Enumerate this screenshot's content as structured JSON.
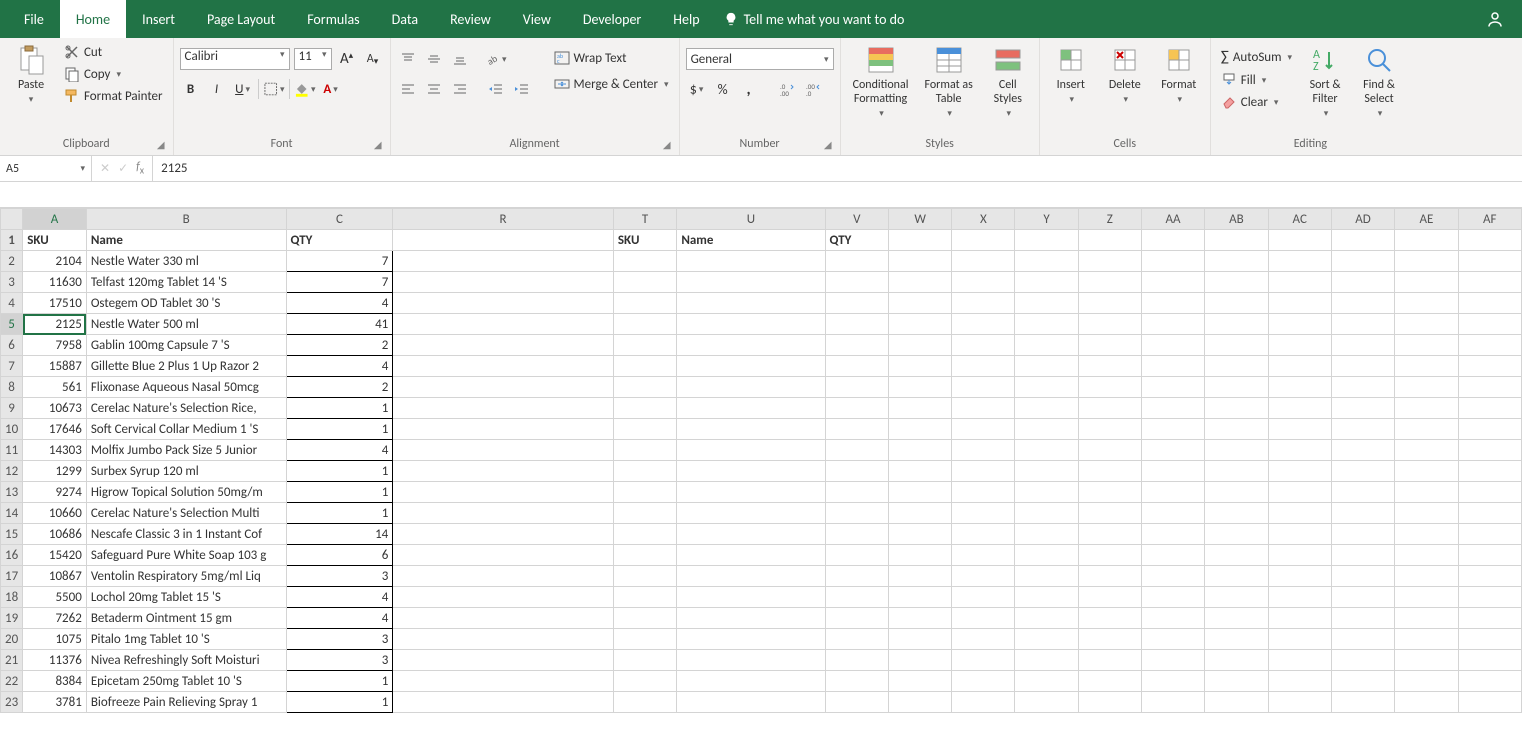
{
  "tabs": [
    "File",
    "Home",
    "Insert",
    "Page Layout",
    "Formulas",
    "Data",
    "Review",
    "View",
    "Developer",
    "Help"
  ],
  "active_tab": "Home",
  "tell_me": "Tell me what you want to do",
  "clipboard": {
    "paste": "Paste",
    "cut": "Cut",
    "copy": "Copy",
    "format_painter": "Format Painter",
    "label": "Clipboard"
  },
  "font": {
    "name": "Calibri",
    "size": "11",
    "label": "Font"
  },
  "alignment": {
    "wrap": "Wrap Text",
    "merge": "Merge & Center",
    "label": "Alignment"
  },
  "number": {
    "format": "General",
    "label": "Number"
  },
  "styles": {
    "cond": "Conditional Formatting",
    "table": "Format as Table",
    "cell": "Cell Styles",
    "label": "Styles"
  },
  "cells": {
    "insert": "Insert",
    "delete": "Delete",
    "format": "Format",
    "label": "Cells"
  },
  "editing": {
    "autosum": "AutoSum",
    "fill": "Fill",
    "clear": "Clear",
    "sort": "Sort & Filter",
    "find": "Find & Select",
    "label": "Editing"
  },
  "name_box": "A5",
  "formula_value": "2125",
  "col_headers": [
    "A",
    "B",
    "C",
    "R",
    "T",
    "U",
    "V",
    "W",
    "X",
    "Y",
    "Z",
    "AA",
    "AB",
    "AC",
    "AD",
    "AE",
    "AF"
  ],
  "header_row": {
    "A": "SKU",
    "B": "Name",
    "C": "QTY",
    "T": "SKU",
    "U": "Name",
    "V": "QTY"
  },
  "rows": [
    {
      "r": 2,
      "sku": "2104",
      "name": "Nestle Water 330 ml",
      "qty": "7"
    },
    {
      "r": 3,
      "sku": "11630",
      "name": "Telfast 120mg Tablet 14 'S",
      "qty": "7"
    },
    {
      "r": 4,
      "sku": "17510",
      "name": "Ostegem OD Tablet 30 'S",
      "qty": "4"
    },
    {
      "r": 5,
      "sku": "2125",
      "name": "Nestle Water 500 ml",
      "qty": "41"
    },
    {
      "r": 6,
      "sku": "7958",
      "name": "Gablin 100mg Capsule 7 'S",
      "qty": "2"
    },
    {
      "r": 7,
      "sku": "15887",
      "name": "Gillette Blue 2 Plus 1 Up Razor 2",
      "qty": "4"
    },
    {
      "r": 8,
      "sku": "561",
      "name": "Flixonase Aqueous Nasal 50mcg",
      "qty": "2"
    },
    {
      "r": 9,
      "sku": "10673",
      "name": "Cerelac Nature's Selection Rice,",
      "qty": "1"
    },
    {
      "r": 10,
      "sku": "17646",
      "name": "Soft Cervical Collar Medium 1 'S",
      "qty": "1"
    },
    {
      "r": 11,
      "sku": "14303",
      "name": "Molfix Jumbo Pack Size 5 Junior",
      "qty": "4"
    },
    {
      "r": 12,
      "sku": "1299",
      "name": "Surbex Syrup 120 ml",
      "qty": "1"
    },
    {
      "r": 13,
      "sku": "9274",
      "name": "Higrow Topical Solution 50mg/m",
      "qty": "1"
    },
    {
      "r": 14,
      "sku": "10660",
      "name": "Cerelac Nature's Selection Multi",
      "qty": "1"
    },
    {
      "r": 15,
      "sku": "10686",
      "name": "Nescafe Classic 3 in 1 Instant Cof",
      "qty": "14"
    },
    {
      "r": 16,
      "sku": "15420",
      "name": "Safeguard Pure White Soap 103 g",
      "qty": "6"
    },
    {
      "r": 17,
      "sku": "10867",
      "name": "Ventolin Respiratory 5mg/ml Liq",
      "qty": "3"
    },
    {
      "r": 18,
      "sku": "5500",
      "name": "Lochol 20mg Tablet 15 'S",
      "qty": "4"
    },
    {
      "r": 19,
      "sku": "7262",
      "name": "Betaderm Ointment 15 gm",
      "qty": "4"
    },
    {
      "r": 20,
      "sku": "1075",
      "name": "Pitalo 1mg Tablet 10 'S",
      "qty": "3"
    },
    {
      "r": 21,
      "sku": "11376",
      "name": "Nivea Refreshingly Soft Moisturi",
      "qty": "3"
    },
    {
      "r": 22,
      "sku": "8384",
      "name": "Epicetam 250mg Tablet 10 'S",
      "qty": "1"
    },
    {
      "r": 23,
      "sku": "3781",
      "name": "Biofreeze Pain Relieving Spray 1",
      "qty": "1"
    }
  ],
  "selected_cell": "A5"
}
